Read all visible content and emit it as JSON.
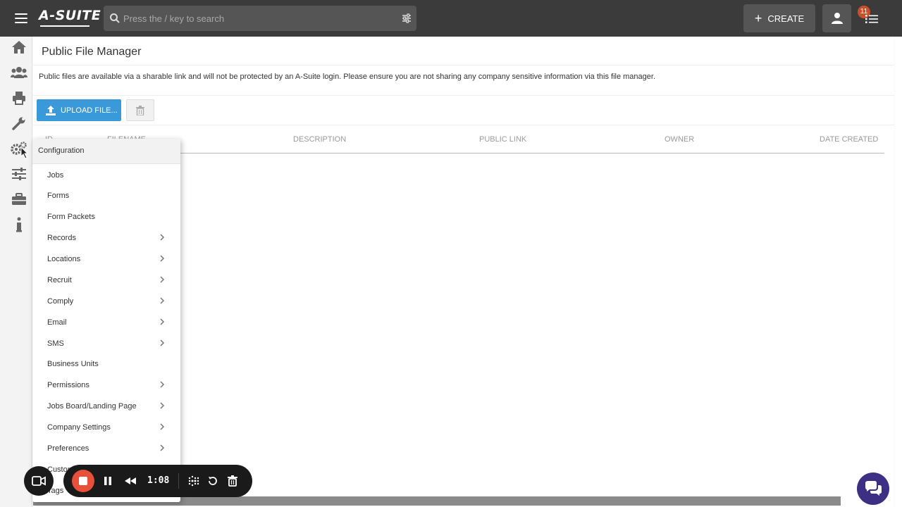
{
  "app": {
    "logo": "A-SUITE"
  },
  "search": {
    "placeholder": "Press the / key to search"
  },
  "header": {
    "create_label": "CREATE",
    "notification_count": "11"
  },
  "rail": {
    "items": [
      "home-icon",
      "users-icon",
      "print-icon",
      "wrench-icon",
      "gears-icon",
      "sliders-icon",
      "briefcase-icon",
      "info-icon"
    ]
  },
  "page": {
    "title": "Public File Manager",
    "notice": "Public files are available via a sharable link and will not be protected by an A-Suite login. Please ensure you are not sharing any company sensitive information via this file manager.",
    "upload_label": "UPLOAD FILE..."
  },
  "table": {
    "columns": [
      "ID",
      "FILENAME",
      "DESCRIPTION",
      "PUBLIC LINK",
      "OWNER",
      "DATE CREATED"
    ]
  },
  "menu": {
    "header": "Configuration",
    "items": [
      {
        "label": "Jobs",
        "has_submenu": false
      },
      {
        "label": "Forms",
        "has_submenu": false
      },
      {
        "label": "Form Packets",
        "has_submenu": false
      },
      {
        "label": "Records",
        "has_submenu": true
      },
      {
        "label": "Locations",
        "has_submenu": true
      },
      {
        "label": "Recruit",
        "has_submenu": true
      },
      {
        "label": "Comply",
        "has_submenu": true
      },
      {
        "label": "Email",
        "has_submenu": true
      },
      {
        "label": "SMS",
        "has_submenu": true
      },
      {
        "label": "Business Units",
        "has_submenu": false
      },
      {
        "label": "Permissions",
        "has_submenu": true
      },
      {
        "label": "Jobs Board/Landing Page",
        "has_submenu": true
      },
      {
        "label": "Company Settings",
        "has_submenu": true
      },
      {
        "label": "Preferences",
        "has_submenu": true
      },
      {
        "label": "Custom",
        "has_submenu": false
      },
      {
        "label": "Tags",
        "has_submenu": false
      }
    ]
  },
  "recorder": {
    "time": "1:08",
    "stop_color": "#e8503a"
  },
  "colors": {
    "topbar": "#3b3b3b",
    "accent": "#3a9ad9",
    "badge": "#c9502a",
    "chat": "#3d2f84"
  }
}
